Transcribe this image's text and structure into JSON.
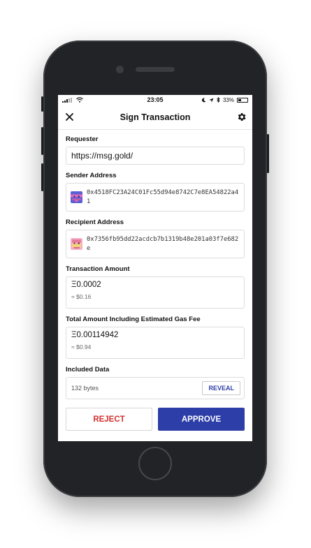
{
  "status_bar": {
    "time": "23:05",
    "battery": "33%"
  },
  "header": {
    "title": "Sign Transaction",
    "close_icon": "close-icon",
    "settings_icon": "gear-icon"
  },
  "requester": {
    "label": "Requester",
    "value": "https://msg.gold/"
  },
  "sender": {
    "label": "Sender Address",
    "address": "0x4518FC23A24C01Fc55d94e8742C7e8EA54822a41"
  },
  "recipient": {
    "label": "Recipient Address",
    "address": "0x7356fb95dd22acdcb7b1319b48e201a03f7e682e"
  },
  "transaction_amount": {
    "label": "Transaction Amount",
    "eth": "Ξ0.0002",
    "usd": "≈ $0.16"
  },
  "total_amount": {
    "label": "Total Amount Including Estimated Gas Fee",
    "eth": "Ξ0.00114942",
    "usd": "≈ $0.94"
  },
  "included_data": {
    "label": "Included Data",
    "size": "132 bytes",
    "reveal_label": "REVEAL"
  },
  "actions": {
    "reject_label": "REJECT",
    "approve_label": "APPROVE"
  },
  "colors": {
    "approve": "#2d3ea8",
    "reject_text": "#d32f2f",
    "reveal_text": "#2d3fa6"
  }
}
